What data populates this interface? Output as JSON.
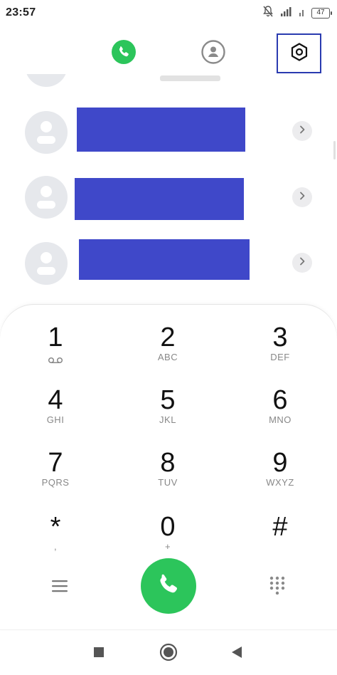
{
  "status_bar": {
    "time": "23:57",
    "battery": "47",
    "icons": [
      "mute-icon",
      "signal-icon",
      "wifi-icon",
      "battery-icon"
    ]
  },
  "top_nav": {
    "tabs": [
      {
        "name": "phone",
        "icon": "phone-icon",
        "active": true
      },
      {
        "name": "contacts",
        "icon": "person-icon",
        "active": false
      },
      {
        "name": "settings",
        "icon": "hexagon-settings-icon",
        "active": false
      }
    ],
    "accent": "#2cc55b",
    "highlight": "#2a3bb0"
  },
  "recents": {
    "rows": [
      {
        "name_redacted": true,
        "icon": "chevron-right-icon"
      },
      {
        "name_redacted": true,
        "icon": "chevron-right-icon"
      },
      {
        "name_redacted": true,
        "icon": "chevron-right-icon"
      }
    ],
    "redaction_color": "#3f48c9"
  },
  "keypad": {
    "keys": [
      {
        "digit": "1",
        "letters": "",
        "sub_icon": "voicemail-icon"
      },
      {
        "digit": "2",
        "letters": "ABC"
      },
      {
        "digit": "3",
        "letters": "DEF"
      },
      {
        "digit": "4",
        "letters": "GHI"
      },
      {
        "digit": "5",
        "letters": "JKL"
      },
      {
        "digit": "6",
        "letters": "MNO"
      },
      {
        "digit": "7",
        "letters": "PQRS"
      },
      {
        "digit": "8",
        "letters": "TUV"
      },
      {
        "digit": "9",
        "letters": "WXYZ"
      },
      {
        "digit": "*",
        "letters": ","
      },
      {
        "digit": "0",
        "letters": "+"
      },
      {
        "digit": "#",
        "letters": ""
      }
    ]
  },
  "bottom_actions": {
    "menu_icon": "menu-icon",
    "call_icon": "phone-icon",
    "dialpad_icon": "dialpad-icon",
    "call_color": "#2cc55b"
  },
  "system_nav": {
    "buttons": [
      "recents-square-icon",
      "home-circle-icon",
      "back-triangle-icon"
    ]
  }
}
